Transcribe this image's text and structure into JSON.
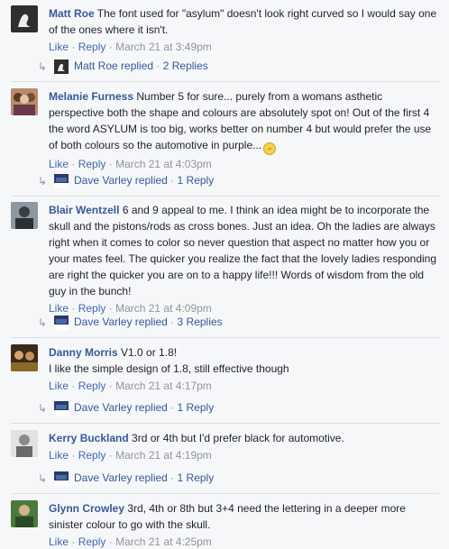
{
  "comments": [
    {
      "author": "Matt Roe",
      "text": "The font used for \"asylum\" doesn't look right curved so I would say one of the ones where it isn't.",
      "like": "Like",
      "reply": "Reply",
      "time": "March 21 at 3:49pm",
      "replier": "Matt Roe replied",
      "reply_count": "2 Replies",
      "avatar_colors": [
        "#3a3a3a",
        "#e8ece8"
      ]
    },
    {
      "author": "Melanie Furness",
      "text": "Number 5 for sure... purely from a womans asthetic perspective both the shape and colours are absolutely spot on! Out of the first 4 the word ASYLUM is too big, works better on number 4 but would prefer the use of both colours so the automotive in purple...",
      "like": "Like",
      "reply": "Reply",
      "time": "March 21 at 4:03pm",
      "replier": "Dave Varley replied",
      "reply_count": "1 Reply",
      "avatar_colors": [
        "#c98e6a",
        "#7a4b3a"
      ]
    },
    {
      "author": "Blair Wentzell",
      "text": "6 and 9 appeal to me. I think an idea might be to incorporate the skull and the pistons/rods as cross bones. Just an idea. Oh the ladies are always right when it comes to color so never question that aspect no matter how you or your mates feel. The quicker you realize the fact that the lovely ladies responding are right the quicker you are on to a happy life!!! Words of wisdom from the old guy in the bunch!",
      "like": "Like",
      "reply": "Reply",
      "time": "March 21 at 4:09pm",
      "replier": "Dave Varley replied",
      "reply_count": "3 Replies",
      "avatar_colors": [
        "#4a5560",
        "#9aa3ad"
      ]
    },
    {
      "author": "Danny Morris",
      "text": "V1.0 or 1.8!",
      "text2": "I like the simple design of 1.8, still effective though",
      "like": "Like",
      "reply": "Reply",
      "time": "March 21 at 4:17pm",
      "replier": "Dave Varley replied",
      "reply_count": "1 Reply",
      "avatar_colors": [
        "#8a6a2a",
        "#3a2a1a"
      ]
    },
    {
      "author": "Kerry Buckland",
      "text": "3rd or 4th but I'd prefer black for automotive.",
      "like": "Like",
      "reply": "Reply",
      "time": "March 21 at 4:19pm",
      "replier": "Dave Varley replied",
      "reply_count": "1 Reply",
      "avatar_colors": [
        "#d8d8d8",
        "#9a9a9a"
      ]
    },
    {
      "author": "Glynn Crowley",
      "text": "3rd, 4th or 8th but 3+4 need the lettering in a deeper more sinister colour to go with the skull.",
      "like": "Like",
      "reply": "Reply",
      "time": "March 21 at 4:25pm",
      "avatar_colors": [
        "#4a7a3a",
        "#2a4a2a"
      ]
    }
  ],
  "colors": {
    "author": "#365899",
    "link": "#4267b2",
    "meta": "#90949c",
    "background": "#f6f7f9"
  }
}
